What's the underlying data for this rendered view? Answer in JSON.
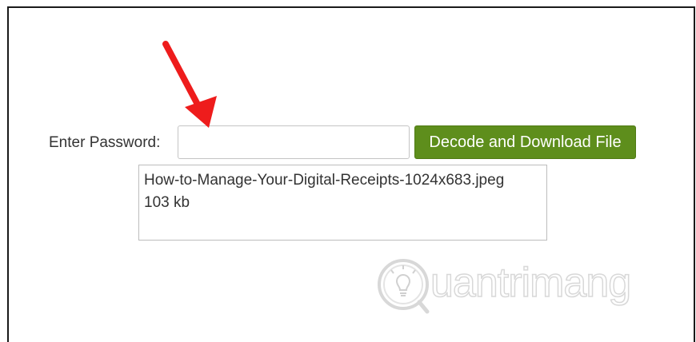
{
  "form": {
    "password_label": "Enter Password:",
    "password_value": "",
    "decode_button_label": "Decode and Download File"
  },
  "file_info": {
    "file_name": "How-to-Manage-Your-Digital-Receipts-1024x683.jpeg",
    "file_size": "103 kb"
  },
  "watermark": {
    "text": "uantrimang",
    "logo_icon": "lightbulb-q-logo-icon"
  },
  "annotation": {
    "arrow_icon": "red-arrow-icon",
    "arrow_color": "#ee1c1c"
  },
  "colors": {
    "button_green": "#5e8e1c",
    "border": "#c4c4c4"
  }
}
